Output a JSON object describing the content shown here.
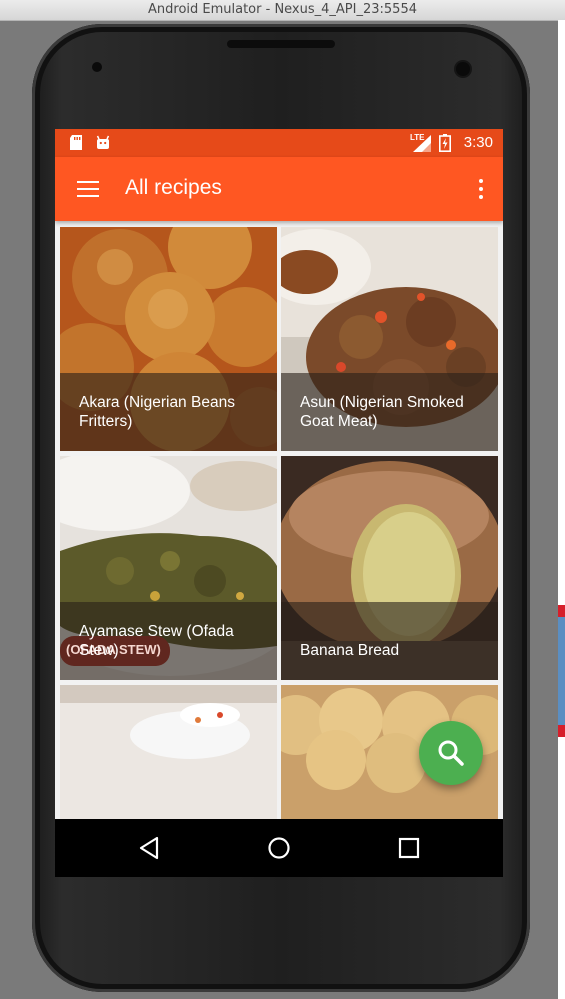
{
  "window": {
    "title": "Android Emulator - Nexus_4_API_23:5554"
  },
  "status_bar": {
    "time": "3:30",
    "network_label": "LTE"
  },
  "app_bar": {
    "title": "All recipes"
  },
  "recipes": [
    {
      "name": "Akara (Nigerian Beans Fritters)"
    },
    {
      "name": "Asun (Nigerian Smoked Goat Meat)"
    },
    {
      "name": "Ayamase Stew (Ofada Stew)"
    },
    {
      "name": "Banana Bread"
    },
    {
      "name": ""
    },
    {
      "name": ""
    }
  ],
  "ayamase_badge": "(OFADA STEW)",
  "fab": {
    "icon": "search-icon"
  },
  "colors": {
    "status_bar": "#e64a19",
    "app_bar": "#ff5722",
    "fab": "#4caf50"
  }
}
